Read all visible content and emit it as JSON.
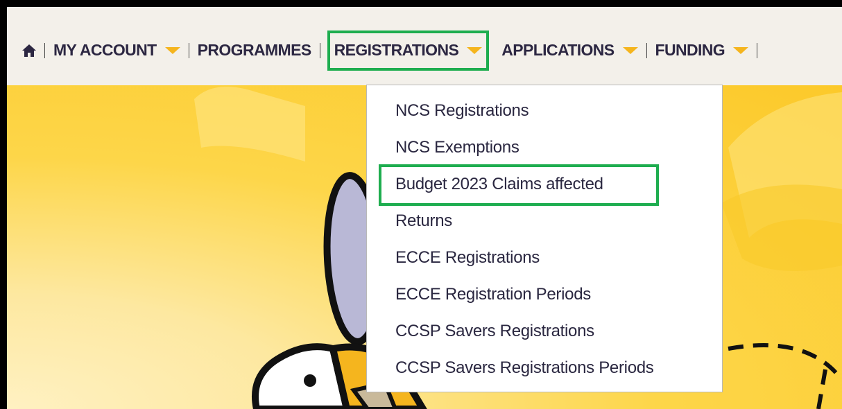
{
  "nav": {
    "items": [
      {
        "label": "MY ACCOUNT"
      },
      {
        "label": "PROGRAMMES"
      },
      {
        "label": "REGISTRATIONS"
      },
      {
        "label": "APPLICATIONS"
      },
      {
        "label": "FUNDING"
      }
    ]
  },
  "dropdown": {
    "items": [
      {
        "label": "NCS Registrations"
      },
      {
        "label": "NCS Exemptions"
      },
      {
        "label": "Budget 2023 Claims affected"
      },
      {
        "label": "Returns"
      },
      {
        "label": "ECCE Registrations"
      },
      {
        "label": "ECCE Registration Periods"
      },
      {
        "label": "CCSP Savers Registrations"
      },
      {
        "label": "CCSP Savers Registrations Periods"
      }
    ]
  },
  "colors": {
    "highlight": "#1ead4f",
    "caret": "#f5b51e",
    "nav_text": "#2c2742",
    "banner": "#fcc92a"
  }
}
